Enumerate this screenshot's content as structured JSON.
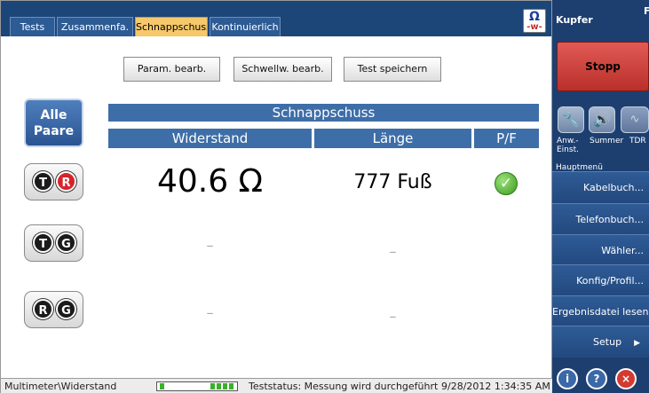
{
  "tabs": [
    {
      "label": "Tests"
    },
    {
      "label": "Zusammenfa."
    },
    {
      "label": "Schnappschuss"
    },
    {
      "label": "Kontinuierlich"
    }
  ],
  "ohm_button": {
    "symbol": "Ω",
    "wave": "-w-"
  },
  "buttons": {
    "param": "Param. bearb.",
    "schwell": "Schwellw. bearb.",
    "save": "Test speichern"
  },
  "alle_paare": {
    "line1": "Alle",
    "line2": "Paare"
  },
  "table": {
    "title": "Schnappschuss",
    "columns": [
      "Widerstand",
      "Länge",
      "P/F"
    ],
    "rows": [
      {
        "pair": [
          "T",
          "R"
        ],
        "resistance": "40.6 Ω",
        "length": "777 Fuß",
        "pf": "✓"
      },
      {
        "pair": [
          "T",
          "G"
        ],
        "resistance": "–",
        "length": "–"
      },
      {
        "pair": [
          "R",
          "G"
        ],
        "resistance": "–",
        "length": "–"
      }
    ]
  },
  "statusbar": {
    "path": "Multimeter\\Widerstand",
    "status": "Teststatus: Messung wird durchgeführt",
    "timestamp": "9/28/2012 1:34:35 AM"
  },
  "right_panel": {
    "title": "Kupfer",
    "edge_char": "F",
    "stop_label": "Stopp",
    "tool_labels": {
      "anw": "Anw.-\nEinst.",
      "summer": "Summer",
      "tdr": "TDR"
    },
    "menu_header": "Hauptmenü",
    "menu": [
      "Kabelbuch...",
      "Telefonbuch...",
      "Wähler...",
      "Konfig/Profil...",
      "Ergebnisdatei lesen",
      "Setup"
    ],
    "round_buttons": {
      "info": "i",
      "help": "?",
      "close": "×"
    }
  },
  "colors": {
    "header_blue": "#1c4578",
    "table_header": "#3e6ea8",
    "active_tab": "#f6c86a",
    "stop_red": "#d64540",
    "pass_green": "#3c9a1e"
  }
}
